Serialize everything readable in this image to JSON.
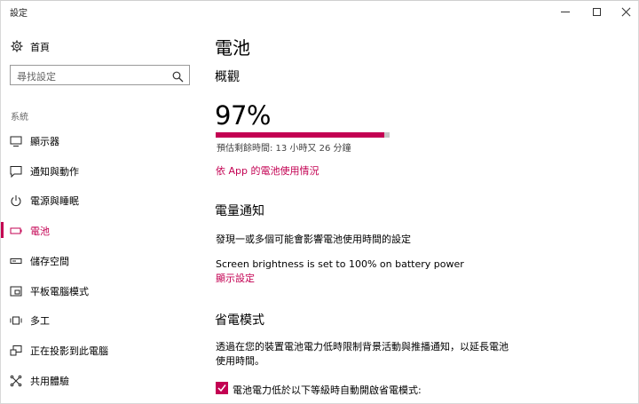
{
  "window": {
    "title": "設定",
    "accent_color": "#c30052"
  },
  "nav": {
    "home_label": "首頁",
    "search_placeholder": "尋找設定",
    "section_label": "系統",
    "items": [
      {
        "label": "顯示器",
        "icon": "display-icon"
      },
      {
        "label": "通知與動作",
        "icon": "notification-icon"
      },
      {
        "label": "電源與睡眠",
        "icon": "power-icon"
      },
      {
        "label": "電池",
        "icon": "battery-icon",
        "active": true
      },
      {
        "label": "儲存空間",
        "icon": "storage-icon"
      },
      {
        "label": "平板電腦模式",
        "icon": "tablet-mode-icon"
      },
      {
        "label": "多工",
        "icon": "multitasking-icon"
      },
      {
        "label": "正在投影到此電腦",
        "icon": "projecting-icon"
      },
      {
        "label": "共用體驗",
        "icon": "shared-experiences-icon"
      }
    ]
  },
  "main": {
    "title": "電池",
    "overview_heading": "概觀",
    "battery_percent": "97%",
    "battery_level": 0.97,
    "remaining_time": "預估剩餘時間: 13 小時又 26 分鐘",
    "by_app_link": "依 App 的電池使用情況",
    "notifications_heading": "電量通知",
    "notifications_text": "發現一或多個可能會影響電池使用時間的設定",
    "brightness_text": "Screen brightness is set to 100% on battery power",
    "display_settings_link": "顯示設定",
    "saver_heading": "省電模式",
    "saver_description": "透過在您的裝置電池電力低時限制背景活動與推播通知，以延長電池使用時間。",
    "saver_checkbox_label": "電池電力低於以下等級時自動開啟省電模式:",
    "saver_checkbox_checked": true
  }
}
